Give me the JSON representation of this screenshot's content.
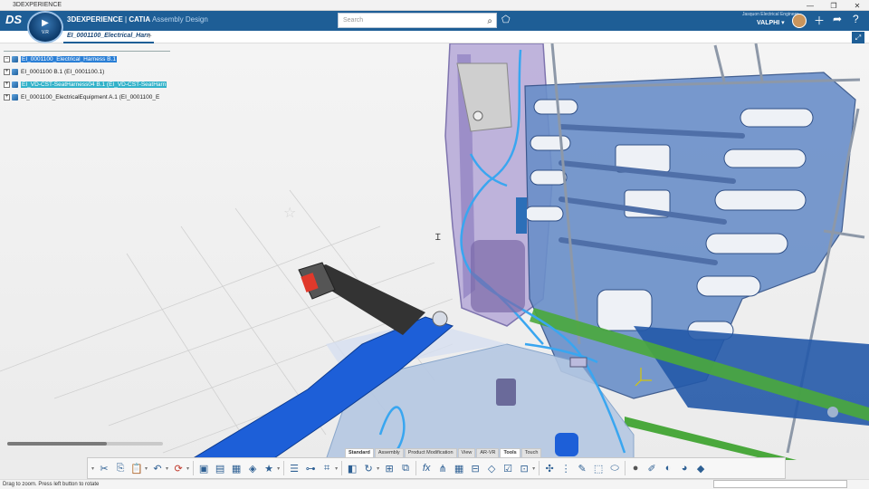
{
  "window": {
    "title": "3DEXPERIENCE",
    "controls": [
      "—",
      "❐",
      "✕"
    ]
  },
  "appbar": {
    "brand_bold": "3DEXPERIENCE",
    "brand_sep": " | ",
    "brand_app": "CATIA",
    "brand_module": " Assembly Design",
    "compass_label": "V.R",
    "search_placeholder": "Search",
    "user_role": "Jasquon Electrical Engineer",
    "user_name": "VALPHI ▾",
    "icons": [
      "plus-icon",
      "share-icon",
      "help-icon"
    ]
  },
  "tabs": {
    "active": "EI_0001100_Electrical_Harn",
    "add": "+"
  },
  "tree": [
    {
      "label": "EI_0001100_Electrical_Harness B.1",
      "style": "sel",
      "expander": "−"
    },
    {
      "label": "EI_0001100 B.1 (EI_0001100.1)",
      "style": "",
      "expander": "+"
    },
    {
      "label": "EI_VD-CST-SeatHarness04 B.1 (EI_VD-CST-SeatHarn",
      "style": "sel2",
      "expander": "+"
    },
    {
      "label": "EI_0001100_ElectricalEquipment A.1 (EI_0001100_E",
      "style": "",
      "expander": "+"
    }
  ],
  "section_tabs": [
    "Standard",
    "Assembly",
    "Product Modification",
    "View",
    "AR-VR",
    "Tools",
    "Touch"
  ],
  "active_section": "Tools",
  "actionbar_icons": [
    "cut-icon",
    "copy-icon",
    "paste-icon",
    "undo-icon",
    "update-icon",
    "capture-icon",
    "snapshot-icon",
    "save-icon",
    "product-icon",
    "favorite-icon",
    "table-icon",
    "tree-icon",
    "measure-icon",
    "cube-icon",
    "refresh-icon",
    "knowledge-icon",
    "catalog-icon",
    "formula-icon",
    "parameters-icon",
    "grid-icon",
    "design-table-icon",
    "rule-icon",
    "check-icon",
    "macro-icon",
    "compass-icon",
    "edit-icon",
    "brush-icon",
    "clean-icon",
    "sphere-icon",
    "pen-icon",
    "eraser-icon",
    "render-icon",
    "material-icon"
  ],
  "status": {
    "message": "Drag to zoom. Press left button to rotate"
  }
}
